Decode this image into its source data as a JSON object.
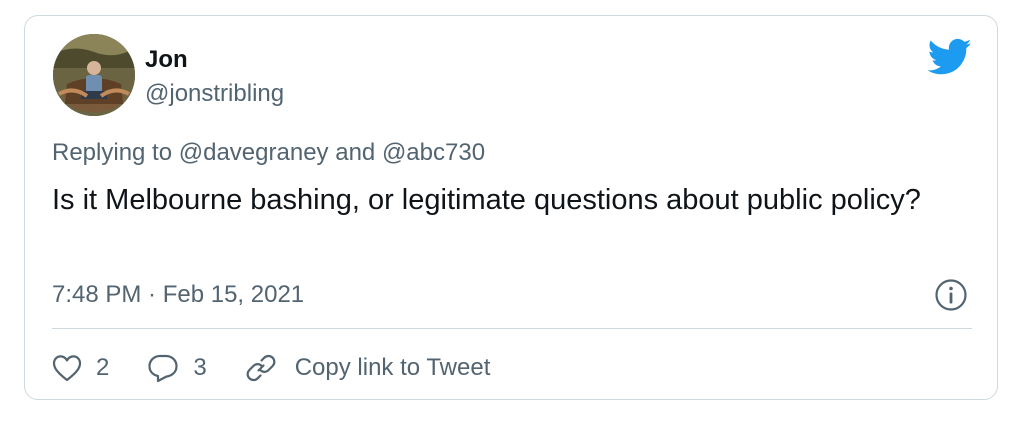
{
  "user": {
    "name": "Jon",
    "handle": "@jonstribling"
  },
  "replying": {
    "prefix": "Replying to ",
    "first": "@davegraney",
    "joiner": " and ",
    "second": "@abc730"
  },
  "tweet": {
    "text": "Is it Melbourne bashing, or legitimate questions about public policy?",
    "timestamp": "7:48 PM · Feb 15, 2021"
  },
  "actions": {
    "likes": "2",
    "replies": "3",
    "copy_link": "Copy link to Tweet"
  },
  "colors": {
    "twitter_blue": "#1d9bf0",
    "secondary_text": "#536471",
    "border": "#cfd9de"
  },
  "icons": [
    "avatar",
    "twitter-bird-icon",
    "info-icon",
    "heart-icon",
    "reply-bubble-icon",
    "link-icon"
  ]
}
